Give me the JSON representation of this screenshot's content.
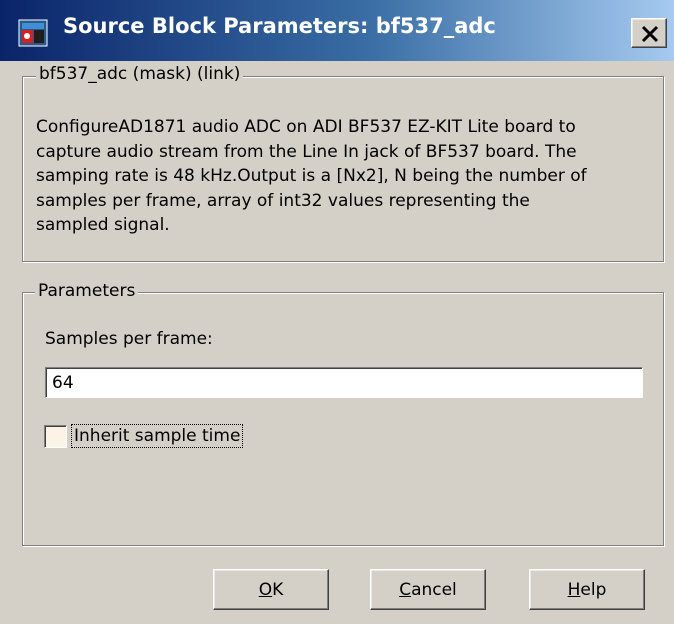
{
  "window": {
    "title": "Source Block Parameters: bf537_adc",
    "app_icon": "simulink-block-icon",
    "close_icon": "close-x-icon"
  },
  "mask_group": {
    "legend": "bf537_adc (mask) (link)",
    "description_lines": [
      "ConfigureAD1871 audio ADC on ADI BF537 EZ-KIT Lite board to",
      "capture audio stream from the Line In jack of BF537  board. The",
      "samping rate is 48 kHz.Output is a [Nx2], N being the number of",
      "samples per frame, array of int32 values representing the",
      "sampled signal."
    ]
  },
  "parameters_group": {
    "legend": "Parameters",
    "samples_per_frame_label": "Samples per frame:",
    "samples_per_frame_value": "64",
    "inherit_checkbox_label": "Inherit sample time",
    "inherit_checked": false
  },
  "buttons": {
    "ok": {
      "mnemonic": "O",
      "rest": "K"
    },
    "cancel": {
      "mnemonic": "C",
      "rest": "ancel"
    },
    "help": {
      "mnemonic": "H",
      "rest": "elp"
    }
  },
  "colors": {
    "title_gradient_start": "#0a246a",
    "title_gradient_end": "#a6caf0",
    "dialog_bg": "#d4d0c8"
  }
}
